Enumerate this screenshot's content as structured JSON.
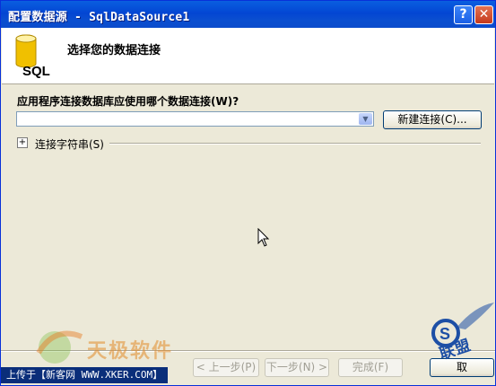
{
  "window": {
    "title": "配置数据源 - SqlDataSource1",
    "help_glyph": "?",
    "close_glyph": "✕"
  },
  "header": {
    "heading": "选择您的数据连接",
    "icon": "database-icon",
    "icon_label": "SQL"
  },
  "connection": {
    "question": "应用程序连接数据库应使用哪个数据连接(W)?",
    "combo_value": "",
    "new_connection_label": "新建连接(C)...",
    "connection_string_label": "连接字符串(S)",
    "expander_glyph": "+"
  },
  "footer": {
    "prev_label": "< 上一步(P)",
    "next_label": "下一步(N) >",
    "finish_label": "完成(F)",
    "cancel_label": "取"
  },
  "watermark": {
    "left_text": "天极软件",
    "caption": "上传于【新客网 WWW.XKER.COM】",
    "right_text": "联盟"
  },
  "colors": {
    "titlebar": "#0346d3",
    "dialog_bg": "#ece9d8",
    "header_bg": "#ffffff",
    "db_icon": "#f0c000"
  }
}
